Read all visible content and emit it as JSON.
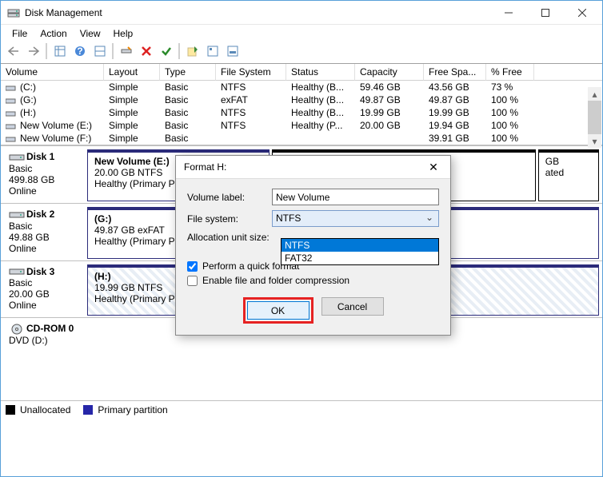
{
  "window": {
    "title": "Disk Management"
  },
  "menu": {
    "file": "File",
    "action": "Action",
    "view": "View",
    "help": "Help"
  },
  "grid": {
    "headers": [
      "Volume",
      "Layout",
      "Type",
      "File System",
      "Status",
      "Capacity",
      "Free Spa...",
      "% Free"
    ],
    "rows": [
      {
        "vol": "(C:)",
        "layout": "Simple",
        "type": "Basic",
        "fs": "NTFS",
        "status": "Healthy (B...",
        "cap": "59.46 GB",
        "free": "43.56 GB",
        "pct": "73 %"
      },
      {
        "vol": "(G:)",
        "layout": "Simple",
        "type": "Basic",
        "fs": "exFAT",
        "status": "Healthy (B...",
        "cap": "49.87 GB",
        "free": "49.87 GB",
        "pct": "100 %"
      },
      {
        "vol": "(H:)",
        "layout": "Simple",
        "type": "Basic",
        "fs": "NTFS",
        "status": "Healthy (B...",
        "cap": "19.99 GB",
        "free": "19.99 GB",
        "pct": "100 %"
      },
      {
        "vol": "New Volume (E:)",
        "layout": "Simple",
        "type": "Basic",
        "fs": "NTFS",
        "status": "Healthy (P...",
        "cap": "20.00 GB",
        "free": "19.94 GB",
        "pct": "100 %"
      },
      {
        "vol": "New Volume (F:)",
        "layout": "Simple",
        "type": "Basic",
        "fs": "",
        "status": "",
        "cap": "",
        "free": "39.91 GB",
        "pct": "100 %"
      }
    ]
  },
  "disks": [
    {
      "name": "Disk 1",
      "kind": "Basic",
      "size": "499.88 GB",
      "state": "Online",
      "parts": [
        {
          "title": "New Volume  (E:)",
          "l2": "20.00 GB NTFS",
          "l3": "Healthy (Primary Pa",
          "w": "36%",
          "cls": ""
        },
        {
          "title": "",
          "l2": "",
          "l3": "",
          "w": "52%",
          "cls": "dark",
          "hidden": true
        },
        {
          "title": "",
          "l2": "GB",
          "l3": "ated",
          "w": "12%",
          "cls": "dark",
          "hidden": true
        }
      ]
    },
    {
      "name": "Disk 2",
      "kind": "Basic",
      "size": "49.88 GB",
      "state": "Online",
      "parts": [
        {
          "title": "(G:)",
          "l2": "49.87 GB exFAT",
          "l3": "Healthy (Primary Pa",
          "w": "100%",
          "cls": ""
        }
      ]
    },
    {
      "name": "Disk 3",
      "kind": "Basic",
      "size": "20.00 GB",
      "state": "Online",
      "parts": [
        {
          "title": "(H:)",
          "l2": "19.99 GB NTFS",
          "l3": "Healthy (Primary Partition)",
          "w": "100%",
          "cls": "stripe"
        }
      ]
    },
    {
      "name": "CD-ROM 0",
      "kind": "DVD (D:)",
      "size": "",
      "state": "",
      "parts": []
    }
  ],
  "legend": {
    "unalloc": "Unallocated",
    "primary": "Primary partition"
  },
  "dialog": {
    "title": "Format H:",
    "vol_label_lbl": "Volume label:",
    "vol_label_val": "New Volume",
    "fs_lbl": "File system:",
    "fs_val": "NTFS",
    "alloc_lbl": "Allocation unit size:",
    "drop_sel": "NTFS",
    "drop_opt": "FAT32",
    "quick": "Perform a quick format",
    "compress": "Enable file and folder compression",
    "ok": "OK",
    "cancel": "Cancel"
  }
}
